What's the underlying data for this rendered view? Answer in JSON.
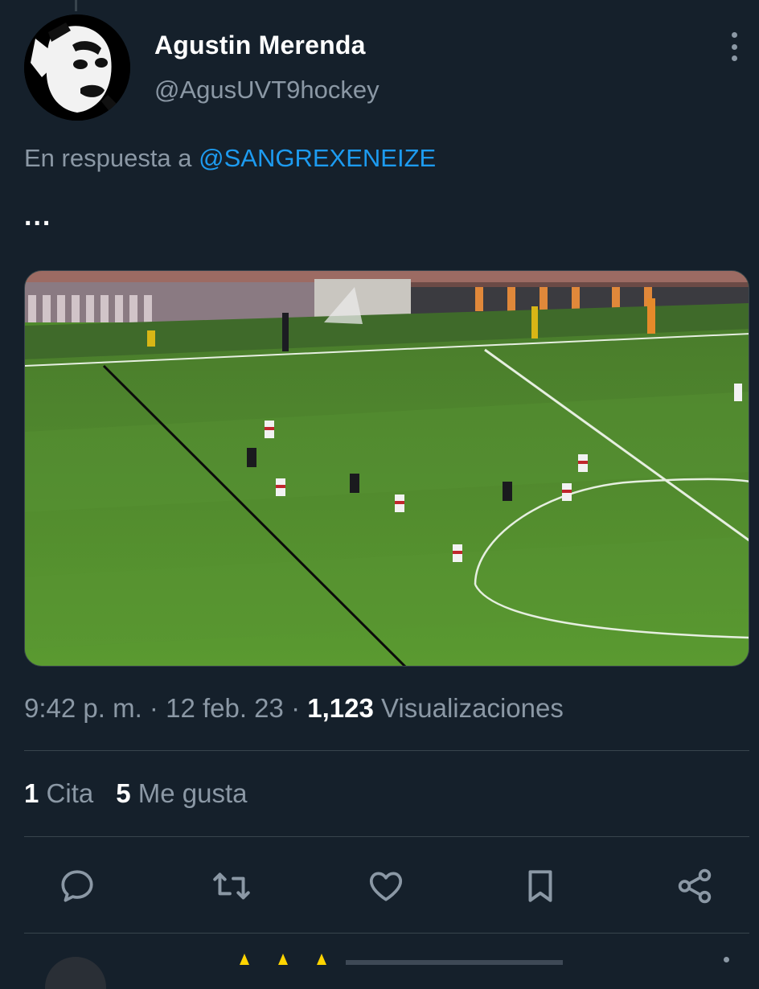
{
  "author": {
    "name": "Agustin Merenda",
    "handle": "@AgusUVT9hockey"
  },
  "reply": {
    "prefix": "En respuesta a",
    "mention": "@SANGREXENEIZE"
  },
  "tweet_text": "...",
  "meta": {
    "time": "9:42 p. m.",
    "date": "12 feb. 23",
    "views_count": "1,123",
    "views_label": "Visualizaciones",
    "separator": "·"
  },
  "stats": {
    "quotes_count": "1",
    "quotes_label": "Cita",
    "likes_count": "5",
    "likes_label": "Me gusta"
  },
  "actions": [
    "reply-icon",
    "retweet-icon",
    "like-icon",
    "bookmark-icon",
    "share-icon"
  ],
  "colors": {
    "background": "#15202b",
    "accent": "#1d9bf0",
    "secondary_text": "#8b98a5",
    "divider": "#38444d",
    "pitch": "#4f8a2c",
    "stars": "#ffd400"
  }
}
